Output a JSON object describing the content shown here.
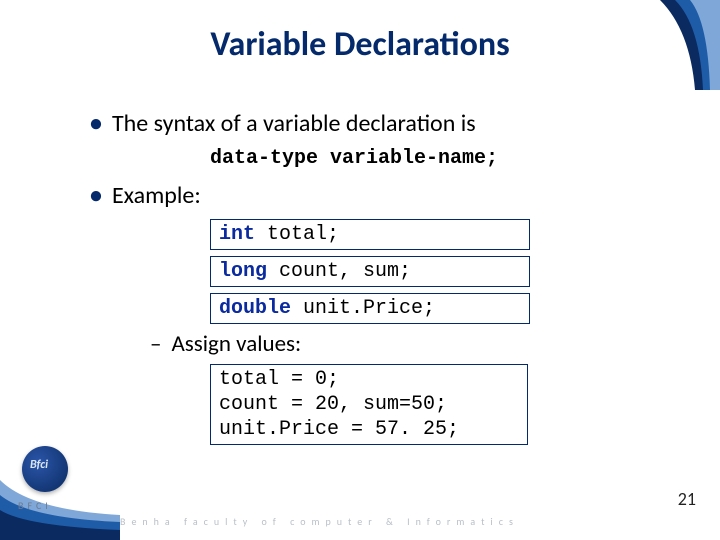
{
  "title": "Variable Declarations",
  "bullet_syntax": "The syntax of a variable declaration is",
  "syntax_line": "data-type variable-name;",
  "bullet_example": "Example:",
  "code1": {
    "kw": "int",
    "rest": " total;"
  },
  "code2": {
    "kw": "long",
    "rest": " count, sum;"
  },
  "code3": {
    "kw": "double",
    "rest": " unit.Price;"
  },
  "sub_assign": "Assign values:",
  "code4": "total = 0;\ncount = 20, sum=50;\nunit.Price = 57. 25;",
  "page_number": "21",
  "footer_text": "Benha faculty of computer & Informatics",
  "bfci": "BFCI"
}
